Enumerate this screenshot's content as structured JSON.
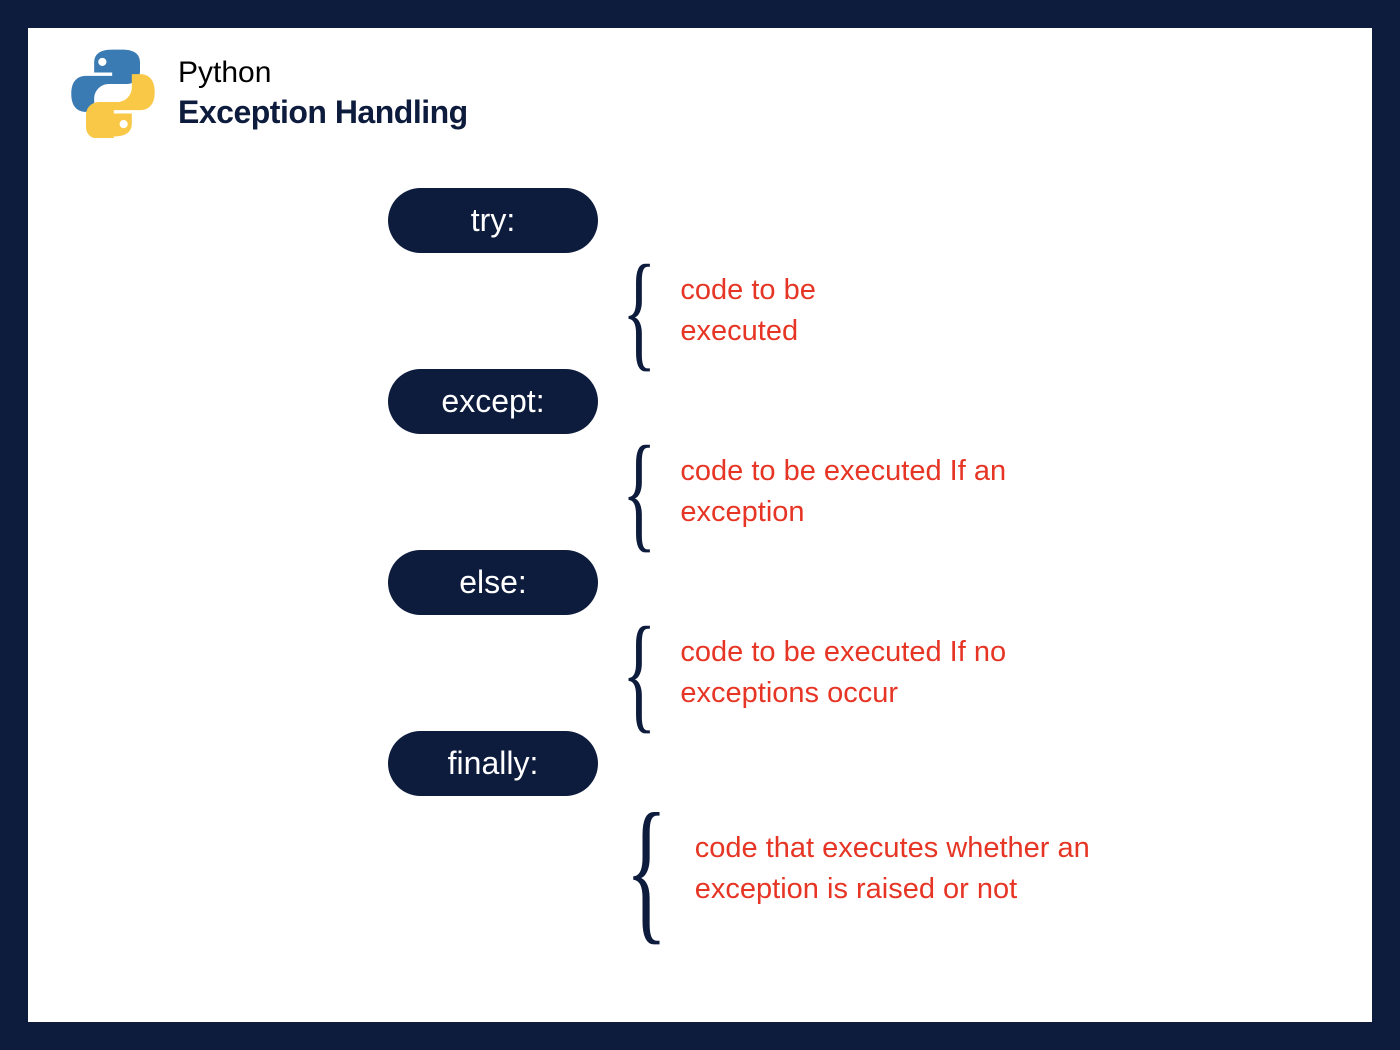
{
  "header": {
    "subtitle": "Python",
    "title": "Exception Handling"
  },
  "blocks": [
    {
      "keyword": "try:",
      "description": "code to be executed"
    },
    {
      "keyword": "except:",
      "description": "code to be executed If an exception"
    },
    {
      "keyword": "else:",
      "description": "code to be executed If no exceptions occur"
    },
    {
      "keyword": "finally:",
      "description": "code that executes whether an exception is raised or not"
    }
  ]
}
